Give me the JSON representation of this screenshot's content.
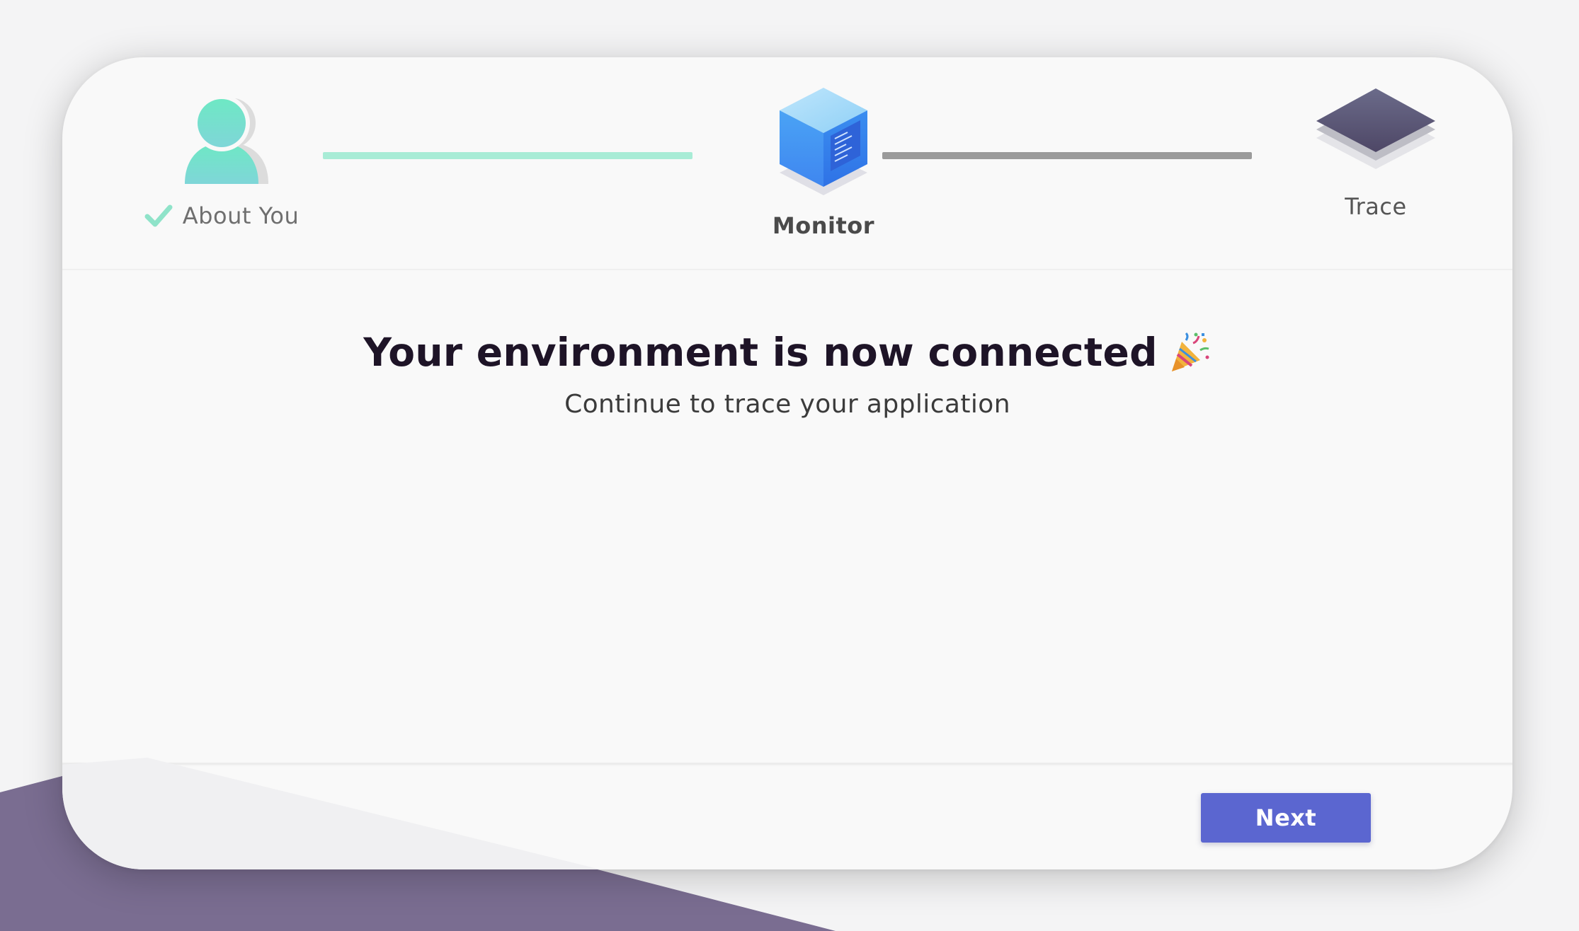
{
  "stepper": {
    "steps": [
      {
        "label": "About You",
        "state": "completed",
        "icon": "user-avatar-icon"
      },
      {
        "label": "Monitor",
        "state": "active",
        "icon": "cube-icon"
      },
      {
        "label": "Trace",
        "state": "upcoming",
        "icon": "layers-icon"
      }
    ],
    "connectors": [
      {
        "state": "completed",
        "color": "#a8ecd6"
      },
      {
        "state": "upcoming",
        "color": "#9b9b9b"
      }
    ]
  },
  "main": {
    "title": "Your environment is now connected",
    "title_emoji": "party-popper-icon",
    "subtitle": "Continue to trace your application"
  },
  "footer": {
    "next_label": "Next"
  },
  "colors": {
    "accent": "#5b66d0",
    "success": "#7ee0c2",
    "background_purple": "#7a6d91",
    "card": "#f9f9f9"
  }
}
